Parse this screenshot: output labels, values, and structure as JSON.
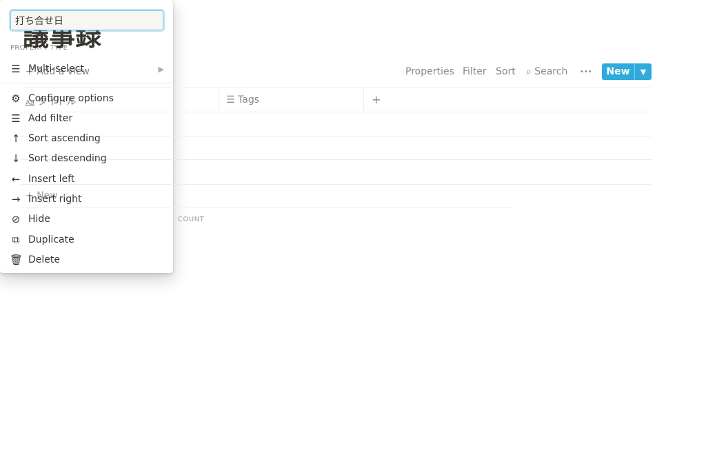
{
  "page": {
    "title": "議事録"
  },
  "toolbar": {
    "add_view": "Add a view",
    "properties": "Properties",
    "filter": "Filter",
    "sort": "Sort",
    "search": "Search",
    "more": "•••",
    "new": "New"
  },
  "table": {
    "columns": [
      {
        "label": "タイトル",
        "icon": "text-icon"
      },
      {
        "label": "Tags",
        "icon": "list-icon"
      }
    ],
    "add_column": "+",
    "new_row": "New",
    "count": "COUNT"
  },
  "menu": {
    "name_value": "打ち合せ日",
    "section": "PROPERTY TYPE",
    "type": "Multi-select",
    "items": [
      {
        "label": "Configure options",
        "icon": "⚙"
      },
      {
        "label": "Add filter",
        "icon": "☰"
      },
      {
        "label": "Sort ascending",
        "icon": "↑"
      },
      {
        "label": "Sort descending",
        "icon": "↓"
      },
      {
        "label": "Insert left",
        "icon": "←"
      },
      {
        "label": "Insert right",
        "icon": "→"
      },
      {
        "label": "Hide",
        "icon": "⊘"
      },
      {
        "label": "Duplicate",
        "icon": "⧉"
      },
      {
        "label": "Delete",
        "icon": "🗑"
      }
    ]
  },
  "colors": {
    "accent": "#2eaadc"
  }
}
